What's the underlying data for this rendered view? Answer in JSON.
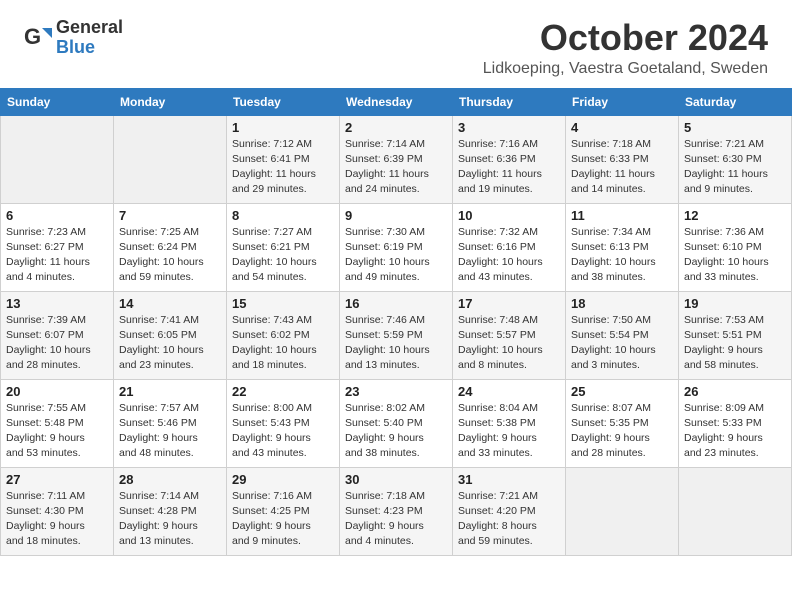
{
  "header": {
    "logo_general": "General",
    "logo_blue": "Blue",
    "month_title": "October 2024",
    "location": "Lidkoeping, Vaestra Goetaland, Sweden"
  },
  "weekdays": [
    "Sunday",
    "Monday",
    "Tuesday",
    "Wednesday",
    "Thursday",
    "Friday",
    "Saturday"
  ],
  "weeks": [
    [
      {
        "day": "",
        "info": ""
      },
      {
        "day": "",
        "info": ""
      },
      {
        "day": "1",
        "info": "Sunrise: 7:12 AM\nSunset: 6:41 PM\nDaylight: 11 hours\nand 29 minutes."
      },
      {
        "day": "2",
        "info": "Sunrise: 7:14 AM\nSunset: 6:39 PM\nDaylight: 11 hours\nand 24 minutes."
      },
      {
        "day": "3",
        "info": "Sunrise: 7:16 AM\nSunset: 6:36 PM\nDaylight: 11 hours\nand 19 minutes."
      },
      {
        "day": "4",
        "info": "Sunrise: 7:18 AM\nSunset: 6:33 PM\nDaylight: 11 hours\nand 14 minutes."
      },
      {
        "day": "5",
        "info": "Sunrise: 7:21 AM\nSunset: 6:30 PM\nDaylight: 11 hours\nand 9 minutes."
      }
    ],
    [
      {
        "day": "6",
        "info": "Sunrise: 7:23 AM\nSunset: 6:27 PM\nDaylight: 11 hours\nand 4 minutes."
      },
      {
        "day": "7",
        "info": "Sunrise: 7:25 AM\nSunset: 6:24 PM\nDaylight: 10 hours\nand 59 minutes."
      },
      {
        "day": "8",
        "info": "Sunrise: 7:27 AM\nSunset: 6:21 PM\nDaylight: 10 hours\nand 54 minutes."
      },
      {
        "day": "9",
        "info": "Sunrise: 7:30 AM\nSunset: 6:19 PM\nDaylight: 10 hours\nand 49 minutes."
      },
      {
        "day": "10",
        "info": "Sunrise: 7:32 AM\nSunset: 6:16 PM\nDaylight: 10 hours\nand 43 minutes."
      },
      {
        "day": "11",
        "info": "Sunrise: 7:34 AM\nSunset: 6:13 PM\nDaylight: 10 hours\nand 38 minutes."
      },
      {
        "day": "12",
        "info": "Sunrise: 7:36 AM\nSunset: 6:10 PM\nDaylight: 10 hours\nand 33 minutes."
      }
    ],
    [
      {
        "day": "13",
        "info": "Sunrise: 7:39 AM\nSunset: 6:07 PM\nDaylight: 10 hours\nand 28 minutes."
      },
      {
        "day": "14",
        "info": "Sunrise: 7:41 AM\nSunset: 6:05 PM\nDaylight: 10 hours\nand 23 minutes."
      },
      {
        "day": "15",
        "info": "Sunrise: 7:43 AM\nSunset: 6:02 PM\nDaylight: 10 hours\nand 18 minutes."
      },
      {
        "day": "16",
        "info": "Sunrise: 7:46 AM\nSunset: 5:59 PM\nDaylight: 10 hours\nand 13 minutes."
      },
      {
        "day": "17",
        "info": "Sunrise: 7:48 AM\nSunset: 5:57 PM\nDaylight: 10 hours\nand 8 minutes."
      },
      {
        "day": "18",
        "info": "Sunrise: 7:50 AM\nSunset: 5:54 PM\nDaylight: 10 hours\nand 3 minutes."
      },
      {
        "day": "19",
        "info": "Sunrise: 7:53 AM\nSunset: 5:51 PM\nDaylight: 9 hours\nand 58 minutes."
      }
    ],
    [
      {
        "day": "20",
        "info": "Sunrise: 7:55 AM\nSunset: 5:48 PM\nDaylight: 9 hours\nand 53 minutes."
      },
      {
        "day": "21",
        "info": "Sunrise: 7:57 AM\nSunset: 5:46 PM\nDaylight: 9 hours\nand 48 minutes."
      },
      {
        "day": "22",
        "info": "Sunrise: 8:00 AM\nSunset: 5:43 PM\nDaylight: 9 hours\nand 43 minutes."
      },
      {
        "day": "23",
        "info": "Sunrise: 8:02 AM\nSunset: 5:40 PM\nDaylight: 9 hours\nand 38 minutes."
      },
      {
        "day": "24",
        "info": "Sunrise: 8:04 AM\nSunset: 5:38 PM\nDaylight: 9 hours\nand 33 minutes."
      },
      {
        "day": "25",
        "info": "Sunrise: 8:07 AM\nSunset: 5:35 PM\nDaylight: 9 hours\nand 28 minutes."
      },
      {
        "day": "26",
        "info": "Sunrise: 8:09 AM\nSunset: 5:33 PM\nDaylight: 9 hours\nand 23 minutes."
      }
    ],
    [
      {
        "day": "27",
        "info": "Sunrise: 7:11 AM\nSunset: 4:30 PM\nDaylight: 9 hours\nand 18 minutes."
      },
      {
        "day": "28",
        "info": "Sunrise: 7:14 AM\nSunset: 4:28 PM\nDaylight: 9 hours\nand 13 minutes."
      },
      {
        "day": "29",
        "info": "Sunrise: 7:16 AM\nSunset: 4:25 PM\nDaylight: 9 hours\nand 9 minutes."
      },
      {
        "day": "30",
        "info": "Sunrise: 7:18 AM\nSunset: 4:23 PM\nDaylight: 9 hours\nand 4 minutes."
      },
      {
        "day": "31",
        "info": "Sunrise: 7:21 AM\nSunset: 4:20 PM\nDaylight: 8 hours\nand 59 minutes."
      },
      {
        "day": "",
        "info": ""
      },
      {
        "day": "",
        "info": ""
      }
    ]
  ]
}
